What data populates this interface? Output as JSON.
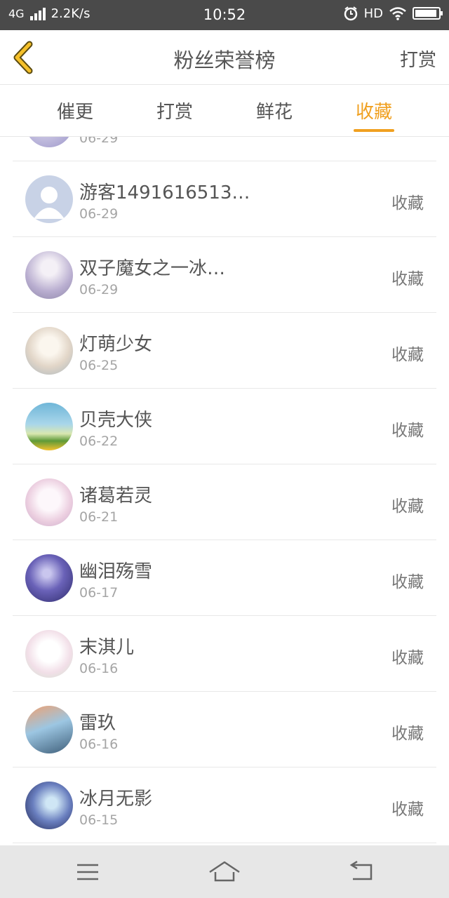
{
  "status_bar": {
    "network": "4G",
    "speed": "2.2K/s",
    "time": "10:52",
    "hd": "HD",
    "battery_level": 0.95,
    "icons": [
      "signal-icon",
      "alarm-icon",
      "wifi-icon",
      "battery-icon"
    ]
  },
  "header": {
    "title": "粉丝荣誉榜",
    "action": "打赏"
  },
  "tabs": [
    {
      "label": "催更"
    },
    {
      "label": "打赏"
    },
    {
      "label": "鲜花"
    },
    {
      "label": "收藏"
    }
  ],
  "active_tab": "收藏",
  "colors": {
    "accent": "#f0a020",
    "status_bar_bg": "#4a4a4a",
    "nav_bar_bg": "#e7e7e7"
  },
  "list": {
    "partial_item": {
      "date": "06-29"
    },
    "items": [
      {
        "name": "游客1491616513…",
        "date": "06-29",
        "type": "收藏"
      },
      {
        "name": "双子魔女之一冰…",
        "date": "06-29",
        "type": "收藏"
      },
      {
        "name": "灯萌少女",
        "date": "06-25",
        "type": "收藏"
      },
      {
        "name": "贝壳大侠",
        "date": "06-22",
        "type": "收藏"
      },
      {
        "name": "诸葛若灵",
        "date": "06-21",
        "type": "收藏"
      },
      {
        "name": "幽泪殇雪",
        "date": "06-17",
        "type": "收藏"
      },
      {
        "name": "末淇儿",
        "date": "06-16",
        "type": "收藏"
      },
      {
        "name": "雷玖",
        "date": "06-16",
        "type": "收藏"
      },
      {
        "name": "冰月无影",
        "date": "06-15",
        "type": "收藏"
      }
    ]
  },
  "nav_bar": {
    "buttons": [
      "menu-icon",
      "home-icon",
      "back-icon"
    ]
  }
}
